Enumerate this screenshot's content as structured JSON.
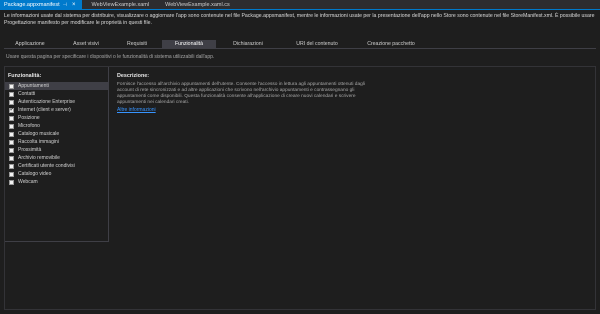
{
  "doc_tabs": [
    {
      "label": "Package.appxmanifest",
      "active": true
    },
    {
      "label": "WebViewExample.xaml",
      "active": false
    },
    {
      "label": "WebViewExample.xaml.cs",
      "active": false
    }
  ],
  "info_text": "Le informazioni usate dal sistema per distribuire, visualizzare o aggiornare l'app sono contenute nel file Package.appxmanifest, mentre le informazioni usate per la presentazione dell'app nello Store sono contenute nel file StoreManifest.xml. È possibile usare Progettazione manifesto per modificare le proprietà in questi file.",
  "config_tabs": [
    {
      "label": "Applicazione",
      "active": false
    },
    {
      "label": "Asset visivi",
      "active": false
    },
    {
      "label": "Requisiti",
      "active": false
    },
    {
      "label": "Funzionalità",
      "active": true
    },
    {
      "label": "Dichiarazioni",
      "active": false
    },
    {
      "label": "URI del contenuto",
      "active": false
    },
    {
      "label": "Creazione pacchetto",
      "active": false
    }
  ],
  "hint": "Usare questa pagina per specificare i dispositivi o le funzionalità di sistema utilizzabili dall'app.",
  "capabilities_header": "Funzionalità:",
  "capabilities": [
    {
      "label": "Appuntamenti",
      "checked": false,
      "selected": true
    },
    {
      "label": "Contatti",
      "checked": false,
      "selected": false
    },
    {
      "label": "Autenticazione Enterprise",
      "checked": false,
      "selected": false
    },
    {
      "label": "Internet (client e server)",
      "checked": true,
      "selected": false
    },
    {
      "label": "Posizione",
      "checked": false,
      "selected": false
    },
    {
      "label": "Microfono",
      "checked": false,
      "selected": false
    },
    {
      "label": "Catalogo musicale",
      "checked": false,
      "selected": false
    },
    {
      "label": "Raccolta immagini",
      "checked": false,
      "selected": false
    },
    {
      "label": "Prossimità",
      "checked": false,
      "selected": false
    },
    {
      "label": "Archivio removibile",
      "checked": false,
      "selected": false
    },
    {
      "label": "Certificati utente condivisi",
      "checked": false,
      "selected": false
    },
    {
      "label": "Catalogo video",
      "checked": false,
      "selected": false
    },
    {
      "label": "Webcam",
      "checked": false,
      "selected": false
    }
  ],
  "description_header": "Descrizione:",
  "description": "Fornisce l'accesso all'archivio appuntamenti dell'utente. Consente l'accesso in lettura agli appuntamenti ottenuti dagli account di rete sincronizzati e ad altre applicazioni che scrivono nell'archivio appuntamenti e contrassegnano gli appuntamenti come disponibili. Questa funzionalità consente all'applicazione di creare nuovi calendari e scrivere appuntamenti nei calendari creati.",
  "more_info": "Altre informazioni",
  "colors": {
    "accent": "#007acc",
    "background": "#1e1e1e",
    "link": "#3794ff"
  }
}
